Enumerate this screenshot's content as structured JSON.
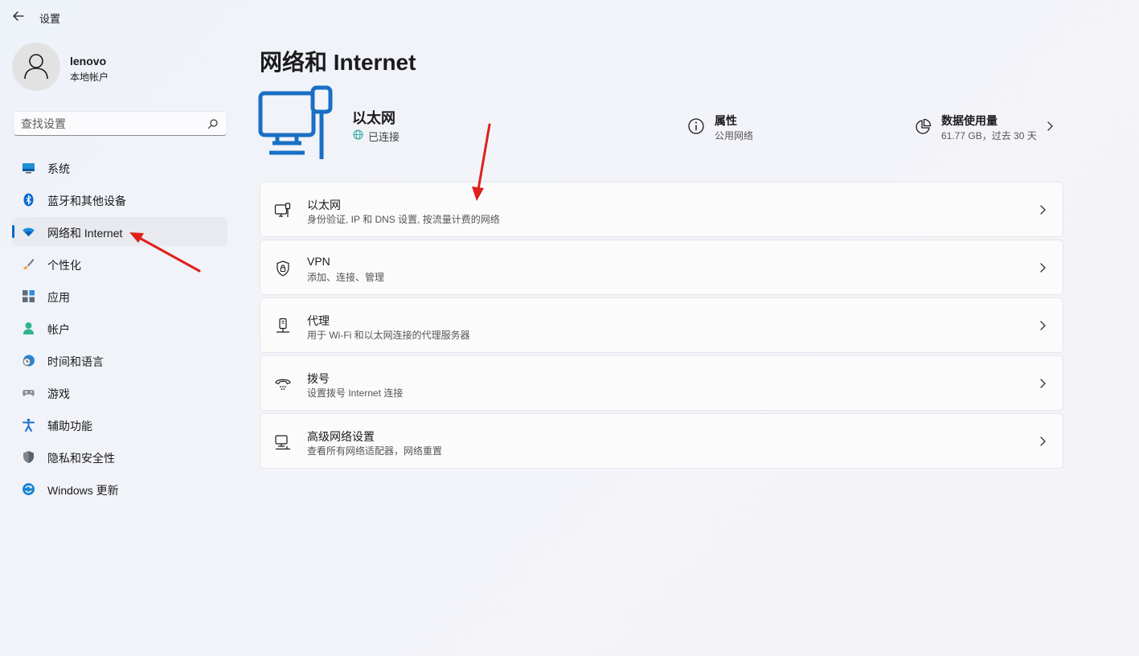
{
  "app": {
    "title": "设置"
  },
  "user": {
    "name": "lenovo",
    "account_type": "本地帐户"
  },
  "search": {
    "placeholder": "查找设置"
  },
  "sidebar": {
    "items": [
      {
        "label": "系统",
        "icon": "system-icon"
      },
      {
        "label": "蓝牙和其他设备",
        "icon": "bluetooth-icon"
      },
      {
        "label": "网络和 Internet",
        "icon": "wifi-icon",
        "active": true
      },
      {
        "label": "个性化",
        "icon": "brush-icon"
      },
      {
        "label": "应用",
        "icon": "apps-icon"
      },
      {
        "label": "帐户",
        "icon": "person-icon"
      },
      {
        "label": "时间和语言",
        "icon": "clock-globe-icon"
      },
      {
        "label": "游戏",
        "icon": "gamepad-icon"
      },
      {
        "label": "辅助功能",
        "icon": "accessibility-icon"
      },
      {
        "label": "隐私和安全性",
        "icon": "shield-icon"
      },
      {
        "label": "Windows 更新",
        "icon": "update-icon"
      }
    ]
  },
  "page": {
    "title": "网络和 Internet"
  },
  "connection": {
    "name": "以太网",
    "status": "已连接"
  },
  "properties": {
    "title": "属性",
    "subtitle": "公用网络"
  },
  "data_usage": {
    "title": "数据使用量",
    "subtitle": "61.77 GB，过去 30 天"
  },
  "cards": [
    {
      "title": "以太网",
      "subtitle": "身份验证, IP 和 DNS 设置, 按流量计费的网络",
      "icon": "ethernet-icon"
    },
    {
      "title": "VPN",
      "subtitle": "添加、连接、管理",
      "icon": "vpn-shield-icon"
    },
    {
      "title": "代理",
      "subtitle": "用于 Wi-Fi 和以太网连接的代理服务器",
      "icon": "proxy-icon"
    },
    {
      "title": "拨号",
      "subtitle": "设置拨号 Internet 连接",
      "icon": "dialup-icon"
    },
    {
      "title": "高级网络设置",
      "subtitle": "查看所有网络适配器，网络重置",
      "icon": "advanced-network-icon"
    }
  ],
  "colors": {
    "accent": "#0067c0",
    "annotation_arrow": "#e0201c"
  }
}
